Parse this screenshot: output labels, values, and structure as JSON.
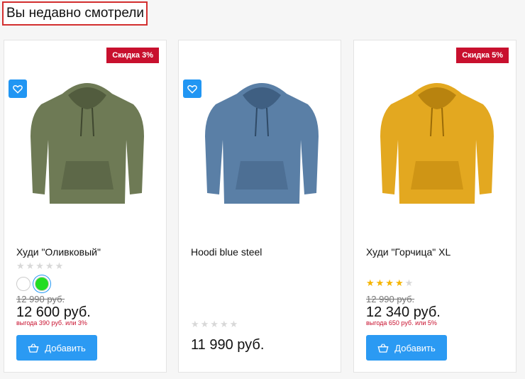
{
  "section": {
    "title": "Вы недавно смотрели"
  },
  "products": [
    {
      "name": "Худи \"Оливковый\"",
      "discount_badge": "Скидка 3%",
      "rating": 0,
      "colors": [
        "#ffffff",
        "#22dd22"
      ],
      "old_price": "12 990 руб.",
      "price": "12 600 руб.",
      "saving": "выгода 390 руб. или 3%",
      "add_label": "Добавить",
      "hoodie_color": "#6e7a55"
    },
    {
      "name": "Hoodi blue steel",
      "rating": 0,
      "price": "11 990 руб.",
      "hoodie_color": "#5a7fa6"
    },
    {
      "name": "Худи \"Горчица\" XL",
      "discount_badge": "Скидка 5%",
      "rating": 4,
      "old_price": "12 990 руб.",
      "price": "12 340 руб.",
      "saving": "выгода 650 руб. или 5%",
      "add_label": "Добавить",
      "hoodie_color": "#e3a820"
    }
  ]
}
